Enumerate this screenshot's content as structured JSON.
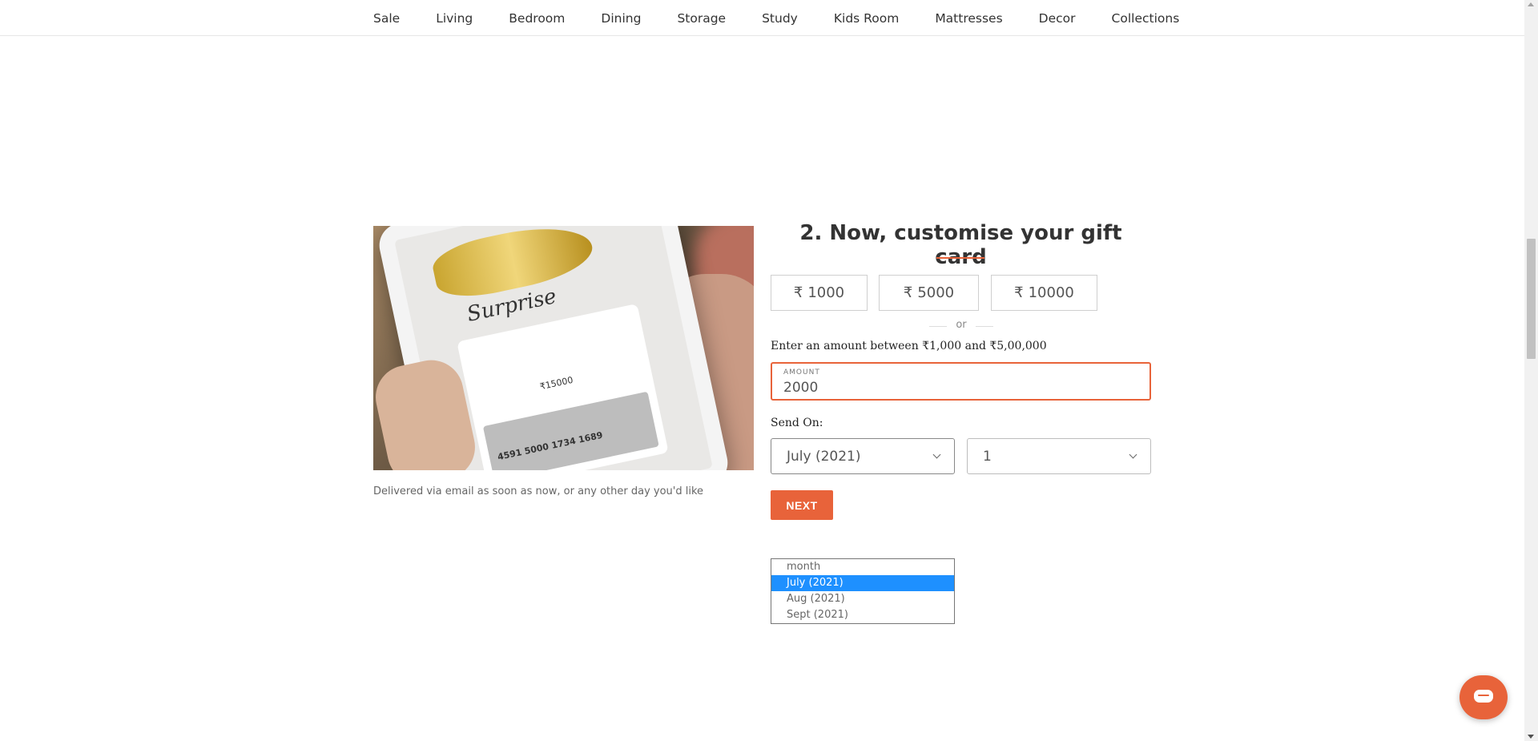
{
  "nav": {
    "items": [
      "Sale",
      "Living",
      "Bedroom",
      "Dining",
      "Storage",
      "Study",
      "Kids Room",
      "Mattresses",
      "Decor",
      "Collections"
    ]
  },
  "image": {
    "caption": "Delivered via email as soon as now, or any other day you'd like",
    "card_script": "Surprise",
    "card_amount": "₹15000",
    "card_number": "4591 5000 1734 1689"
  },
  "form": {
    "title": "2. Now, customise your gift card",
    "presets": [
      {
        "currency": "₹",
        "value": "1000"
      },
      {
        "currency": "₹",
        "value": "5000"
      },
      {
        "currency": "₹",
        "value": "10000"
      }
    ],
    "or_text": "or",
    "range_label": "Enter an amount between ₹1,000 and  ₹5,00,000",
    "amount_label": "AMOUNT",
    "amount_value": "2000",
    "send_on_label": "Send On:",
    "month_selected": "July (2021)",
    "day_selected": "1",
    "next_label": "NEXT",
    "month_options": [
      {
        "label": "month",
        "selected": false
      },
      {
        "label": "July (2021)",
        "selected": true
      },
      {
        "label": "Aug (2021)",
        "selected": false
      },
      {
        "label": "Sept (2021)",
        "selected": false
      }
    ]
  },
  "colors": {
    "accent": "#e8633a",
    "selection": "#1e90ff"
  }
}
